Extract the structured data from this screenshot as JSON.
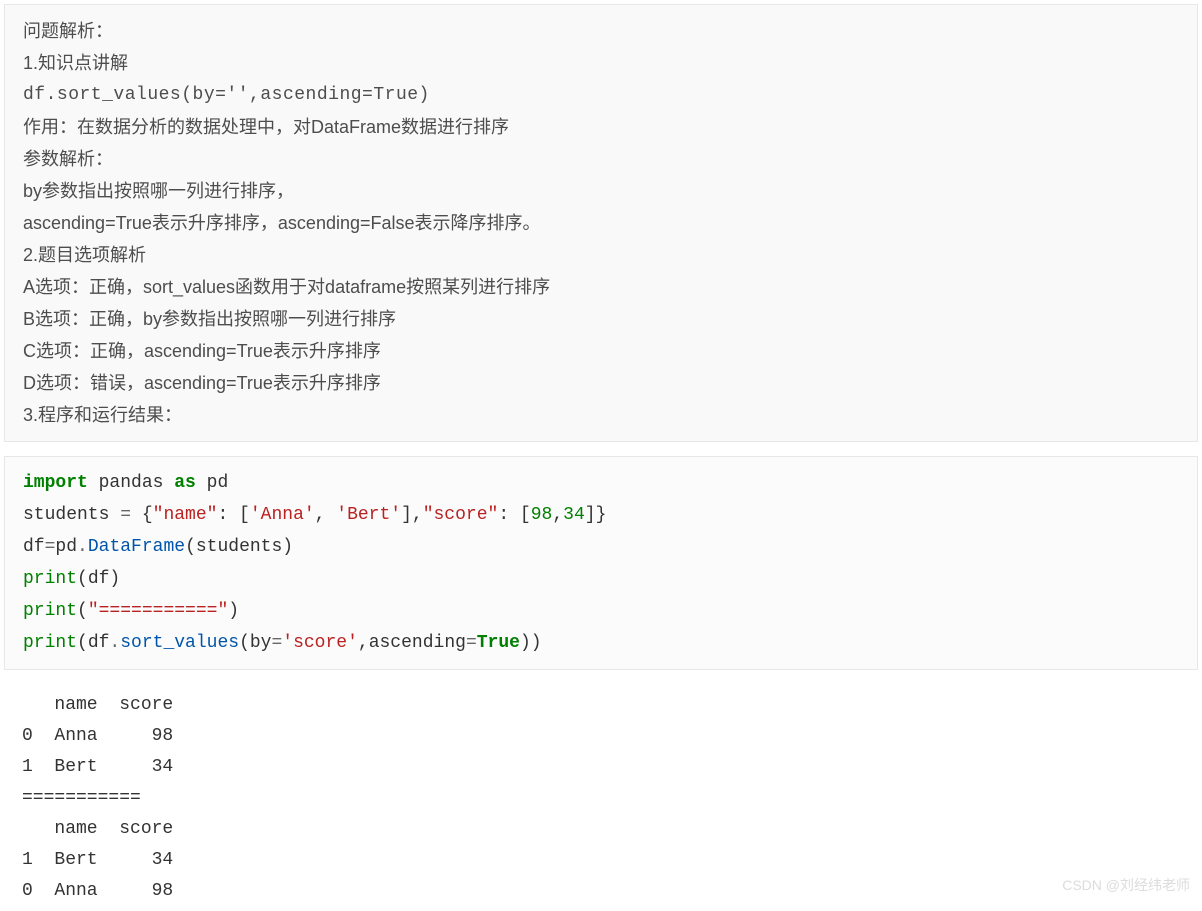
{
  "explain": {
    "line1": "问题解析：",
    "line2": "1.知识点讲解",
    "line3": "df.sort_values(by='',ascending=True)",
    "line4": "作用：在数据分析的数据处理中，对DataFrame数据进行排序",
    "line5": "参数解析：",
    "line6": "by参数指出按照哪一列进行排序，",
    "line7": "ascending=True表示升序排序，ascending=False表示降序排序。",
    "line8": "2.题目选项解析",
    "line9": "A选项：正确，sort_values函数用于对dataframe按照某列进行排序",
    "line10": "B选项：正确，by参数指出按照哪一列进行排序",
    "line11": "C选项：正确，ascending=True表示升序排序",
    "line12": "D选项：错误，ascending=True表示升序排序",
    "line13": "3.程序和运行结果："
  },
  "code": {
    "import_kw": "import",
    "pandas": " pandas ",
    "as_kw": "as",
    "pd": " pd",
    "l2a": "students ",
    "eq": "=",
    "l2b": " {",
    "str_name": "\"name\"",
    "colon": ": [",
    "str_anna": "'Anna'",
    "comma": ", ",
    "str_bert": "'Bert'",
    "l2c": "],",
    "str_score": "\"score\"",
    "l2d": ": [",
    "n98": "98",
    "comma2": ",",
    "n34": "34",
    "l2e": "]}",
    "l3a": "df",
    "l3b": "pd",
    "dot": ".",
    "dataframe": "DataFrame",
    "l3c": "(students)",
    "print": "print",
    "l4b": "(df)",
    "l5b": "(",
    "str_sep": "\"===========\"",
    "l5c": ")",
    "l6b": "(df",
    "sort_values": "sort_values",
    "l6c": "(by",
    "str_score2": "'score'",
    "l6d": ",ascending",
    "true": "True",
    "l6e": "))"
  },
  "output": {
    "text": "   name  score\n0  Anna     98\n1  Bert     34\n===========\n   name  score\n1  Bert     34\n0  Anna     98"
  },
  "watermark": "CSDN @刘经纬老师"
}
